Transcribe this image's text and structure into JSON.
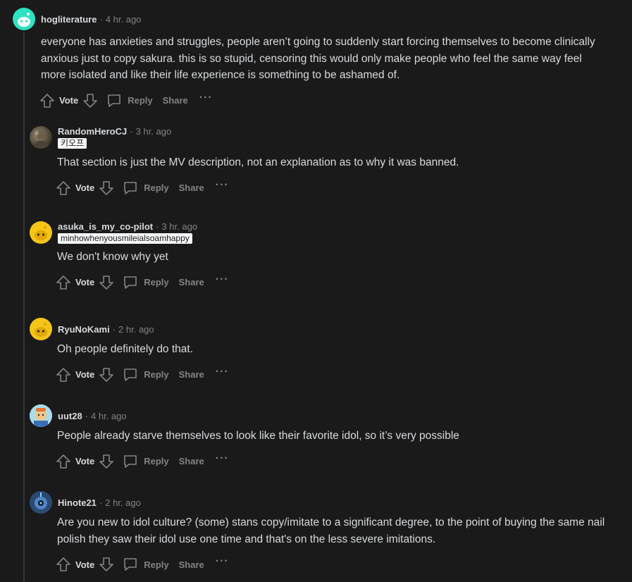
{
  "colors": {
    "background": "#1a1a1b",
    "text": "#d7dadc",
    "muted": "#818384",
    "thread_line": "#343536",
    "flair_bg": "#f6f7f8"
  },
  "actions": {
    "vote_label": "Vote",
    "reply_label": "Reply",
    "share_label": "Share",
    "more_label": "···"
  },
  "separator": "·",
  "comments": [
    {
      "username": "hogliterature",
      "time": "4 hr. ago",
      "avatar": "snoo-teal-icon",
      "flair": "",
      "body": "everyone has anxieties and struggles, people aren’t going to suddenly start forcing themselves to become clinically anxious just to copy sakura. this is so stupid, censoring this would only make people who feel the same way feel more isolated and like their life experience is something to be ashamed of."
    },
    {
      "username": "RandomHeroCJ",
      "time": "3 hr. ago",
      "avatar": "photo-avatar-icon",
      "flair": "키오프",
      "body": "That section is just the MV description, not an explanation as to why it was banned."
    },
    {
      "username": "asuka_is_my_co-pilot",
      "time": "3 hr. ago",
      "avatar": "snoo-yellow-icon",
      "flair": "minhowhenyousmileialsoamhappy",
      "body": "We don't know why yet"
    },
    {
      "username": "RyuNoKami",
      "time": "2 hr. ago",
      "avatar": "snoo-yellow-icon",
      "flair": "",
      "body": "Oh people definitely do that."
    },
    {
      "username": "uut28",
      "time": "4 hr. ago",
      "avatar": "cartoon-avatar-icon",
      "flair": "",
      "body": "People already starve themselves to look like their favorite idol, so it’s very possible"
    },
    {
      "username": "Hinote21",
      "time": "2 hr. ago",
      "avatar": "robot-avatar-icon",
      "flair": "",
      "body": "Are you new to idol culture? (some) stans copy/imitate to a significant degree, to the point of buying the same nail polish they saw their idol use one time and that's on the less severe imitations."
    }
  ]
}
